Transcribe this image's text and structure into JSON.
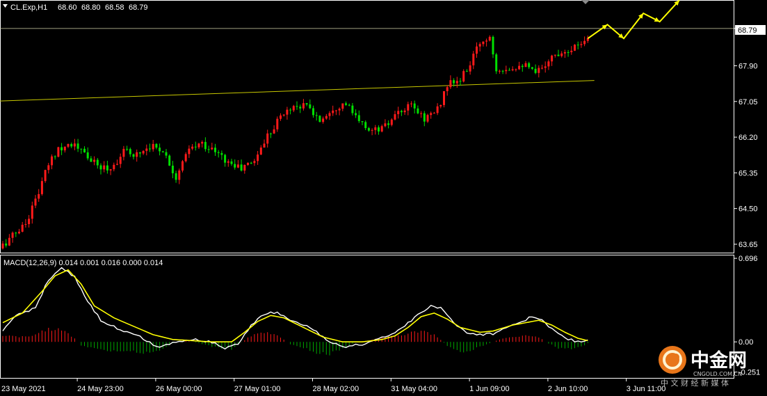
{
  "chart_data": [
    {
      "type": "candlestick",
      "title": "CL.Exp,H1",
      "ohlc_header": [
        "68.60",
        "68.80",
        "68.58",
        "68.79"
      ],
      "current_price": 68.79,
      "current_price_label": "68.79",
      "y_ticks": [
        "68.79",
        "67.90",
        "67.05",
        "66.20",
        "65.35",
        "64.50",
        "63.65"
      ],
      "y_tick_values": [
        68.79,
        67.9,
        67.05,
        66.2,
        65.35,
        64.5,
        63.65
      ],
      "ylim": [
        63.45,
        69.45
      ],
      "x_ticks": [
        "23 May 2021",
        "24 May 23:00",
        "26 May 00:00",
        "27 May 01:00",
        "28 May 02:00",
        "31 May 04:00",
        "1 Jun 09:00",
        "2 Jun 10:00",
        "3 Jun 11:00"
      ],
      "bar_count": 180,
      "x_tick_bars": [
        0,
        23,
        47,
        71,
        95,
        119,
        143,
        167,
        191
      ],
      "anchors": [
        [
          0,
          63.55
        ],
        [
          4,
          63.85
        ],
        [
          8,
          64.15
        ],
        [
          12,
          64.9
        ],
        [
          15,
          65.55
        ],
        [
          18,
          65.95
        ],
        [
          22,
          66.05
        ],
        [
          26,
          65.8
        ],
        [
          30,
          65.5
        ],
        [
          34,
          65.45
        ],
        [
          38,
          65.85
        ],
        [
          42,
          65.8
        ],
        [
          46,
          66.0
        ],
        [
          50,
          65.9
        ],
        [
          54,
          65.25
        ],
        [
          58,
          65.9
        ],
        [
          62,
          66.05
        ],
        [
          66,
          65.85
        ],
        [
          70,
          65.6
        ],
        [
          74,
          65.45
        ],
        [
          78,
          65.65
        ],
        [
          82,
          66.25
        ],
        [
          86,
          66.7
        ],
        [
          90,
          66.95
        ],
        [
          94,
          66.95
        ],
        [
          98,
          66.6
        ],
        [
          102,
          66.9
        ],
        [
          106,
          67.0
        ],
        [
          110,
          66.55
        ],
        [
          114,
          66.35
        ],
        [
          118,
          66.45
        ],
        [
          122,
          66.75
        ],
        [
          126,
          66.95
        ],
        [
          130,
          66.65
        ],
        [
          134,
          66.85
        ],
        [
          137,
          67.45
        ],
        [
          141,
          67.55
        ],
        [
          144,
          67.95
        ],
        [
          147,
          68.45
        ],
        [
          150,
          68.6
        ],
        [
          152,
          67.85
        ],
        [
          156,
          67.85
        ],
        [
          160,
          67.95
        ],
        [
          164,
          67.7
        ],
        [
          168,
          68.05
        ],
        [
          172,
          68.25
        ],
        [
          176,
          68.35
        ],
        [
          179,
          68.55
        ]
      ],
      "support_line": [
        [
          -1,
          67.06
        ],
        [
          181,
          67.55
        ]
      ],
      "projection": [
        [
          179,
          68.55
        ],
        [
          185,
          68.88
        ],
        [
          190,
          68.55
        ],
        [
          196,
          69.15
        ],
        [
          201,
          68.95
        ],
        [
          207,
          69.46
        ]
      ],
      "colors": {
        "up": "#ff1a1a",
        "down": "#00e000",
        "level": "#c8c800",
        "grid": "#ffffff",
        "arrows": "#ffff00"
      }
    },
    {
      "type": "line",
      "title": "MACD(12,26,9) 0.014 0.001 0.016 0.000 0.014",
      "y_ticks": [
        "0.696",
        "0.00",
        "-0.251"
      ],
      "ylim": [
        -0.3,
        0.72
      ],
      "series": [
        {
          "name": "MACD",
          "color": "#ffffff",
          "anchors": [
            [
              0,
              0.1
            ],
            [
              4,
              0.22
            ],
            [
              10,
              0.28
            ],
            [
              14,
              0.52
            ],
            [
              18,
              0.62
            ],
            [
              22,
              0.54
            ],
            [
              26,
              0.34
            ],
            [
              30,
              0.18
            ],
            [
              36,
              0.1
            ],
            [
              42,
              0.04
            ],
            [
              48,
              -0.05
            ],
            [
              52,
              0.0
            ],
            [
              58,
              0.02
            ],
            [
              64,
              0.0
            ],
            [
              68,
              -0.05
            ],
            [
              72,
              -0.02
            ],
            [
              76,
              0.14
            ],
            [
              80,
              0.23
            ],
            [
              84,
              0.25
            ],
            [
              88,
              0.18
            ],
            [
              94,
              0.12
            ],
            [
              100,
              0.0
            ],
            [
              105,
              -0.04
            ],
            [
              110,
              -0.02
            ],
            [
              114,
              0.02
            ],
            [
              118,
              0.05
            ],
            [
              122,
              0.11
            ],
            [
              126,
              0.2
            ],
            [
              131,
              0.3
            ],
            [
              134,
              0.28
            ],
            [
              138,
              0.16
            ],
            [
              142,
              0.08
            ],
            [
              146,
              0.06
            ],
            [
              150,
              0.07
            ],
            [
              154,
              0.12
            ],
            [
              158,
              0.16
            ],
            [
              162,
              0.21
            ],
            [
              164,
              0.2
            ],
            [
              168,
              0.11
            ],
            [
              172,
              0.03
            ],
            [
              176,
              0.0
            ],
            [
              179,
              0.02
            ]
          ]
        },
        {
          "name": "Signal",
          "color": "#ffff00",
          "anchors": [
            [
              0,
              0.16
            ],
            [
              6,
              0.24
            ],
            [
              12,
              0.42
            ],
            [
              16,
              0.55
            ],
            [
              20,
              0.6
            ],
            [
              24,
              0.48
            ],
            [
              28,
              0.3
            ],
            [
              34,
              0.2
            ],
            [
              40,
              0.13
            ],
            [
              46,
              0.06
            ],
            [
              52,
              0.02
            ],
            [
              58,
              0.01
            ],
            [
              64,
              0.0
            ],
            [
              70,
              0.0
            ],
            [
              74,
              0.08
            ],
            [
              78,
              0.17
            ],
            [
              82,
              0.22
            ],
            [
              86,
              0.2
            ],
            [
              92,
              0.12
            ],
            [
              98,
              0.04
            ],
            [
              104,
              0.0
            ],
            [
              110,
              0.0
            ],
            [
              116,
              0.02
            ],
            [
              120,
              0.05
            ],
            [
              124,
              0.12
            ],
            [
              128,
              0.21
            ],
            [
              132,
              0.24
            ],
            [
              136,
              0.19
            ],
            [
              140,
              0.12
            ],
            [
              146,
              0.08
            ],
            [
              150,
              0.09
            ],
            [
              156,
              0.14
            ],
            [
              160,
              0.16
            ],
            [
              164,
              0.18
            ],
            [
              168,
              0.14
            ],
            [
              172,
              0.08
            ],
            [
              176,
              0.03
            ],
            [
              179,
              0.01
            ]
          ]
        }
      ],
      "histogram": {
        "colors": {
          "up": "#ff1a1a",
          "down": "#00aa00"
        },
        "anchors": [
          [
            0,
            0.05
          ],
          [
            8,
            0.04
          ],
          [
            14,
            0.11
          ],
          [
            18,
            0.1
          ],
          [
            22,
            0.03
          ],
          [
            24,
            -0.03
          ],
          [
            30,
            -0.07
          ],
          [
            34,
            -0.08
          ],
          [
            38,
            -0.07
          ],
          [
            42,
            -0.09
          ],
          [
            48,
            -0.07
          ],
          [
            52,
            -0.01
          ],
          [
            56,
            0.01
          ],
          [
            60,
            -0.01
          ],
          [
            64,
            -0.04
          ],
          [
            70,
            -0.06
          ],
          [
            72,
            -0.02
          ],
          [
            76,
            0.05
          ],
          [
            80,
            0.08
          ],
          [
            84,
            0.06
          ],
          [
            88,
            -0.02
          ],
          [
            92,
            -0.05
          ],
          [
            96,
            -0.09
          ],
          [
            100,
            -0.1
          ],
          [
            104,
            -0.06
          ],
          [
            108,
            0.0
          ],
          [
            112,
            0.01
          ],
          [
            116,
            0.04
          ],
          [
            120,
            0.05
          ],
          [
            124,
            0.07
          ],
          [
            128,
            0.09
          ],
          [
            132,
            0.06
          ],
          [
            136,
            -0.03
          ],
          [
            140,
            -0.09
          ],
          [
            144,
            -0.06
          ],
          [
            148,
            -0.02
          ],
          [
            152,
            0.02
          ],
          [
            156,
            0.04
          ],
          [
            160,
            0.05
          ],
          [
            164,
            0.04
          ],
          [
            166,
            0.0
          ],
          [
            170,
            -0.05
          ],
          [
            174,
            -0.06
          ],
          [
            178,
            -0.03
          ],
          [
            179,
            -0.01
          ]
        ]
      }
    }
  ],
  "watermark": {
    "brand": "中金网",
    "domain": "CNGOLD.COM.CN",
    "tagline": "中 文 财 经 新 媒 体"
  }
}
